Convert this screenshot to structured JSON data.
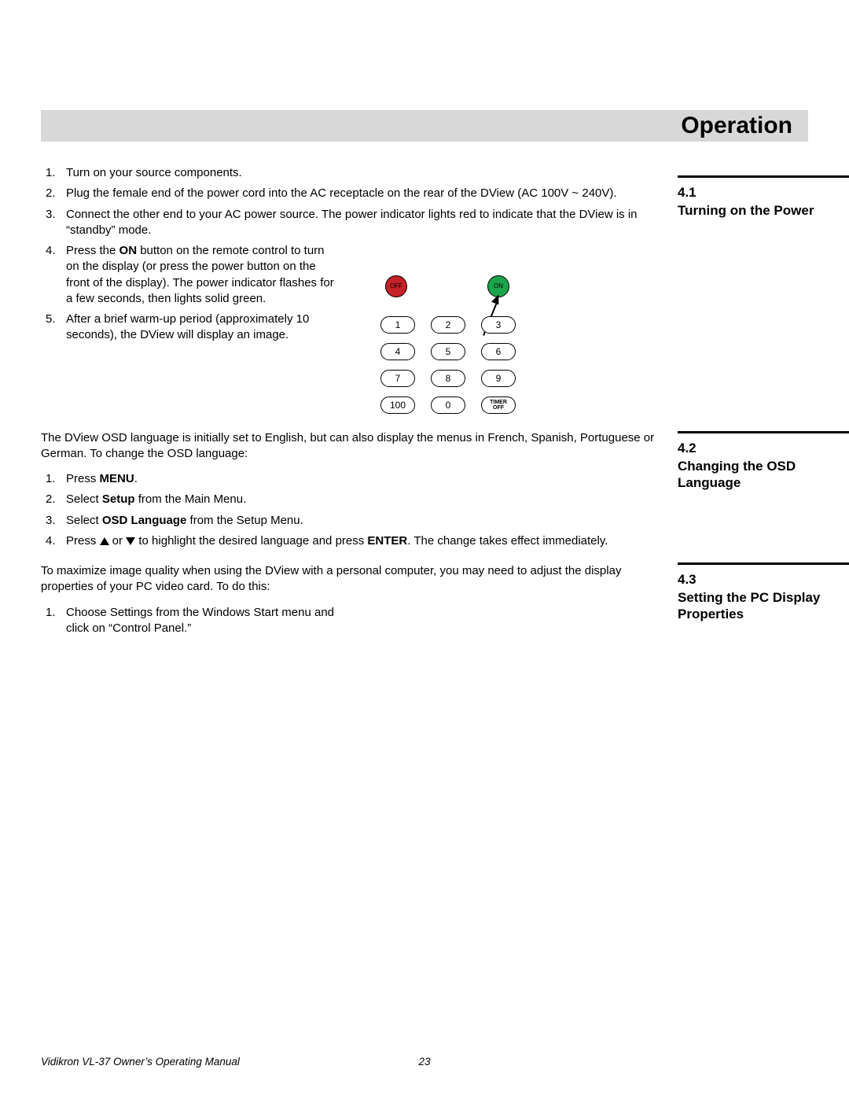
{
  "chapter_title": "Operation",
  "sections": [
    {
      "num": "4.1",
      "title": "Turning on the Power"
    },
    {
      "num": "4.2",
      "title": "Changing the OSD Language"
    },
    {
      "num": "4.3",
      "title": "Setting the PC Display Properties"
    }
  ],
  "sec41": {
    "steps": [
      "Turn on your source components.",
      "Plug the female end of the power cord into the AC receptacle on the rear of the DView (AC 100V ~ 240V).",
      "Connect the other end to your AC power source. The power indicator lights red to indicate that the DView is in “standby” mode."
    ],
    "step4_a": "Press the ",
    "step4_bold": "ON",
    "step4_b": " button on the remote control to turn on the display (or press the power button on the front of the display). The power indicator flashes for a few seconds, then lights solid green.",
    "step5": "After a brief warm-up period (approximately 10 seconds), the DView will display an image."
  },
  "sec42": {
    "intro": "The DView OSD language is initially set to English, but can also display the menus in French, Spanish, Portuguese or German. To change the OSD language:",
    "s1_a": "Press ",
    "s1_bold": "MENU",
    "s1_b": ".",
    "s2_a": "Select ",
    "s2_bold": "Setup",
    "s2_b": " from the Main Menu.",
    "s3_a": "Select ",
    "s3_bold": "OSD Language",
    "s3_b": " from the Setup Menu.",
    "s4_a": "Press ",
    "s4_b": " or ",
    "s4_c": " to highlight the desired language and press ",
    "s4_bold": "ENTER",
    "s4_d": ". The change takes effect immediately."
  },
  "sec43": {
    "intro": "To maximize image quality when using the DView with a personal computer, you may need to adjust the display properties of your PC video card. To do this:",
    "step1": "Choose Settings from the Windows Start menu and click on “Control Panel.”"
  },
  "remote": {
    "off": "OFF",
    "on": "ON",
    "b1": "1",
    "b2": "2",
    "b3": "3",
    "b4": "4",
    "b5": "5",
    "b6": "6",
    "b7": "7",
    "b8": "8",
    "b9": "9",
    "b100": "100",
    "b0": "0",
    "timer1": "TIMER",
    "timer2": "OFF"
  },
  "footer": {
    "left": "Vidikron VL-37 Owner’s Operating Manual",
    "page": "23"
  }
}
